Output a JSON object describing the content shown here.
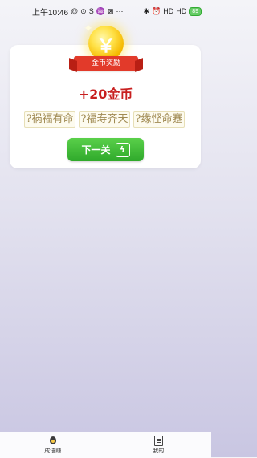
{
  "status_bar": {
    "time": "上午10:46",
    "icons_left": [
      "@",
      "⊙",
      "S",
      "♒",
      "⊠",
      "⋯"
    ],
    "icons_right": [
      "✱",
      "⏰",
      "HD",
      "HD"
    ],
    "battery": "89"
  },
  "reward_card": {
    "badge_label": "金币奖励",
    "coin_symbol": "￥",
    "reward_text": "+20金币",
    "idioms": [
      "?祸福有命",
      "?福寿齐天",
      "?缘悭命蹇"
    ],
    "next_button_label": "下一关"
  },
  "tab_bar": {
    "tabs": [
      {
        "label": "成语赚",
        "icon": "egg-icon"
      },
      {
        "label": "我的",
        "icon": "document-icon"
      }
    ]
  },
  "colors": {
    "reward_red": "#c81f1f",
    "button_green": "#3cb934",
    "coin_gold": "#f5b900"
  }
}
